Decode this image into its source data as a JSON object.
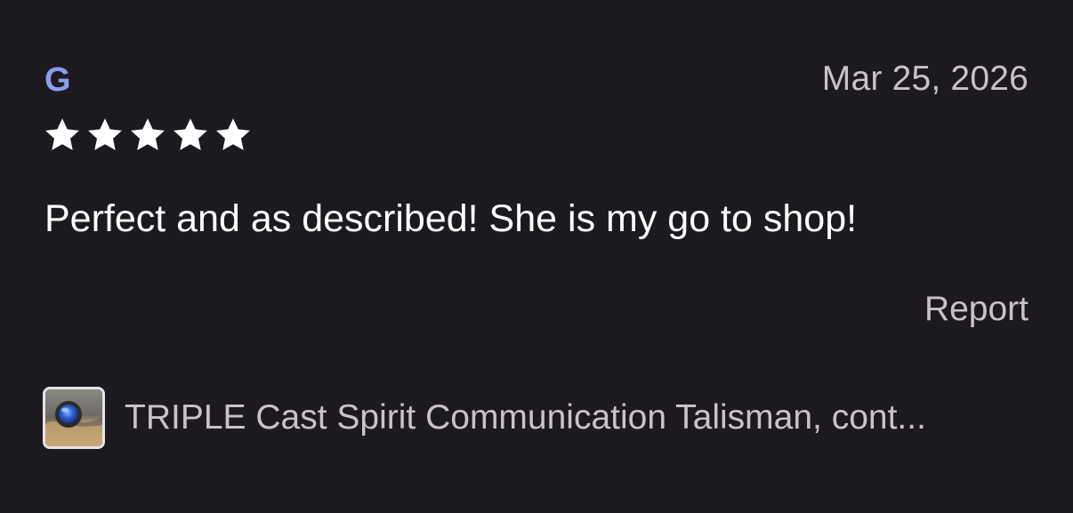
{
  "review": {
    "author": "G",
    "date": "Mar 25, 2026",
    "rating": 5,
    "rating_max": 5,
    "text": "Perfect and as described! She is my go to shop!",
    "report_label": "Report",
    "listing_title": "TRIPLE Cast Spirit Communication Talisman, cont..."
  },
  "icons": {
    "star": "star-icon",
    "thumbnail": "product-thumbnail"
  },
  "colors": {
    "background": "#1c1a1e",
    "author": "#8a9ef0",
    "secondary_text": "#c7c2cc",
    "primary_text": "#ffffff",
    "star": "#ffffff"
  }
}
